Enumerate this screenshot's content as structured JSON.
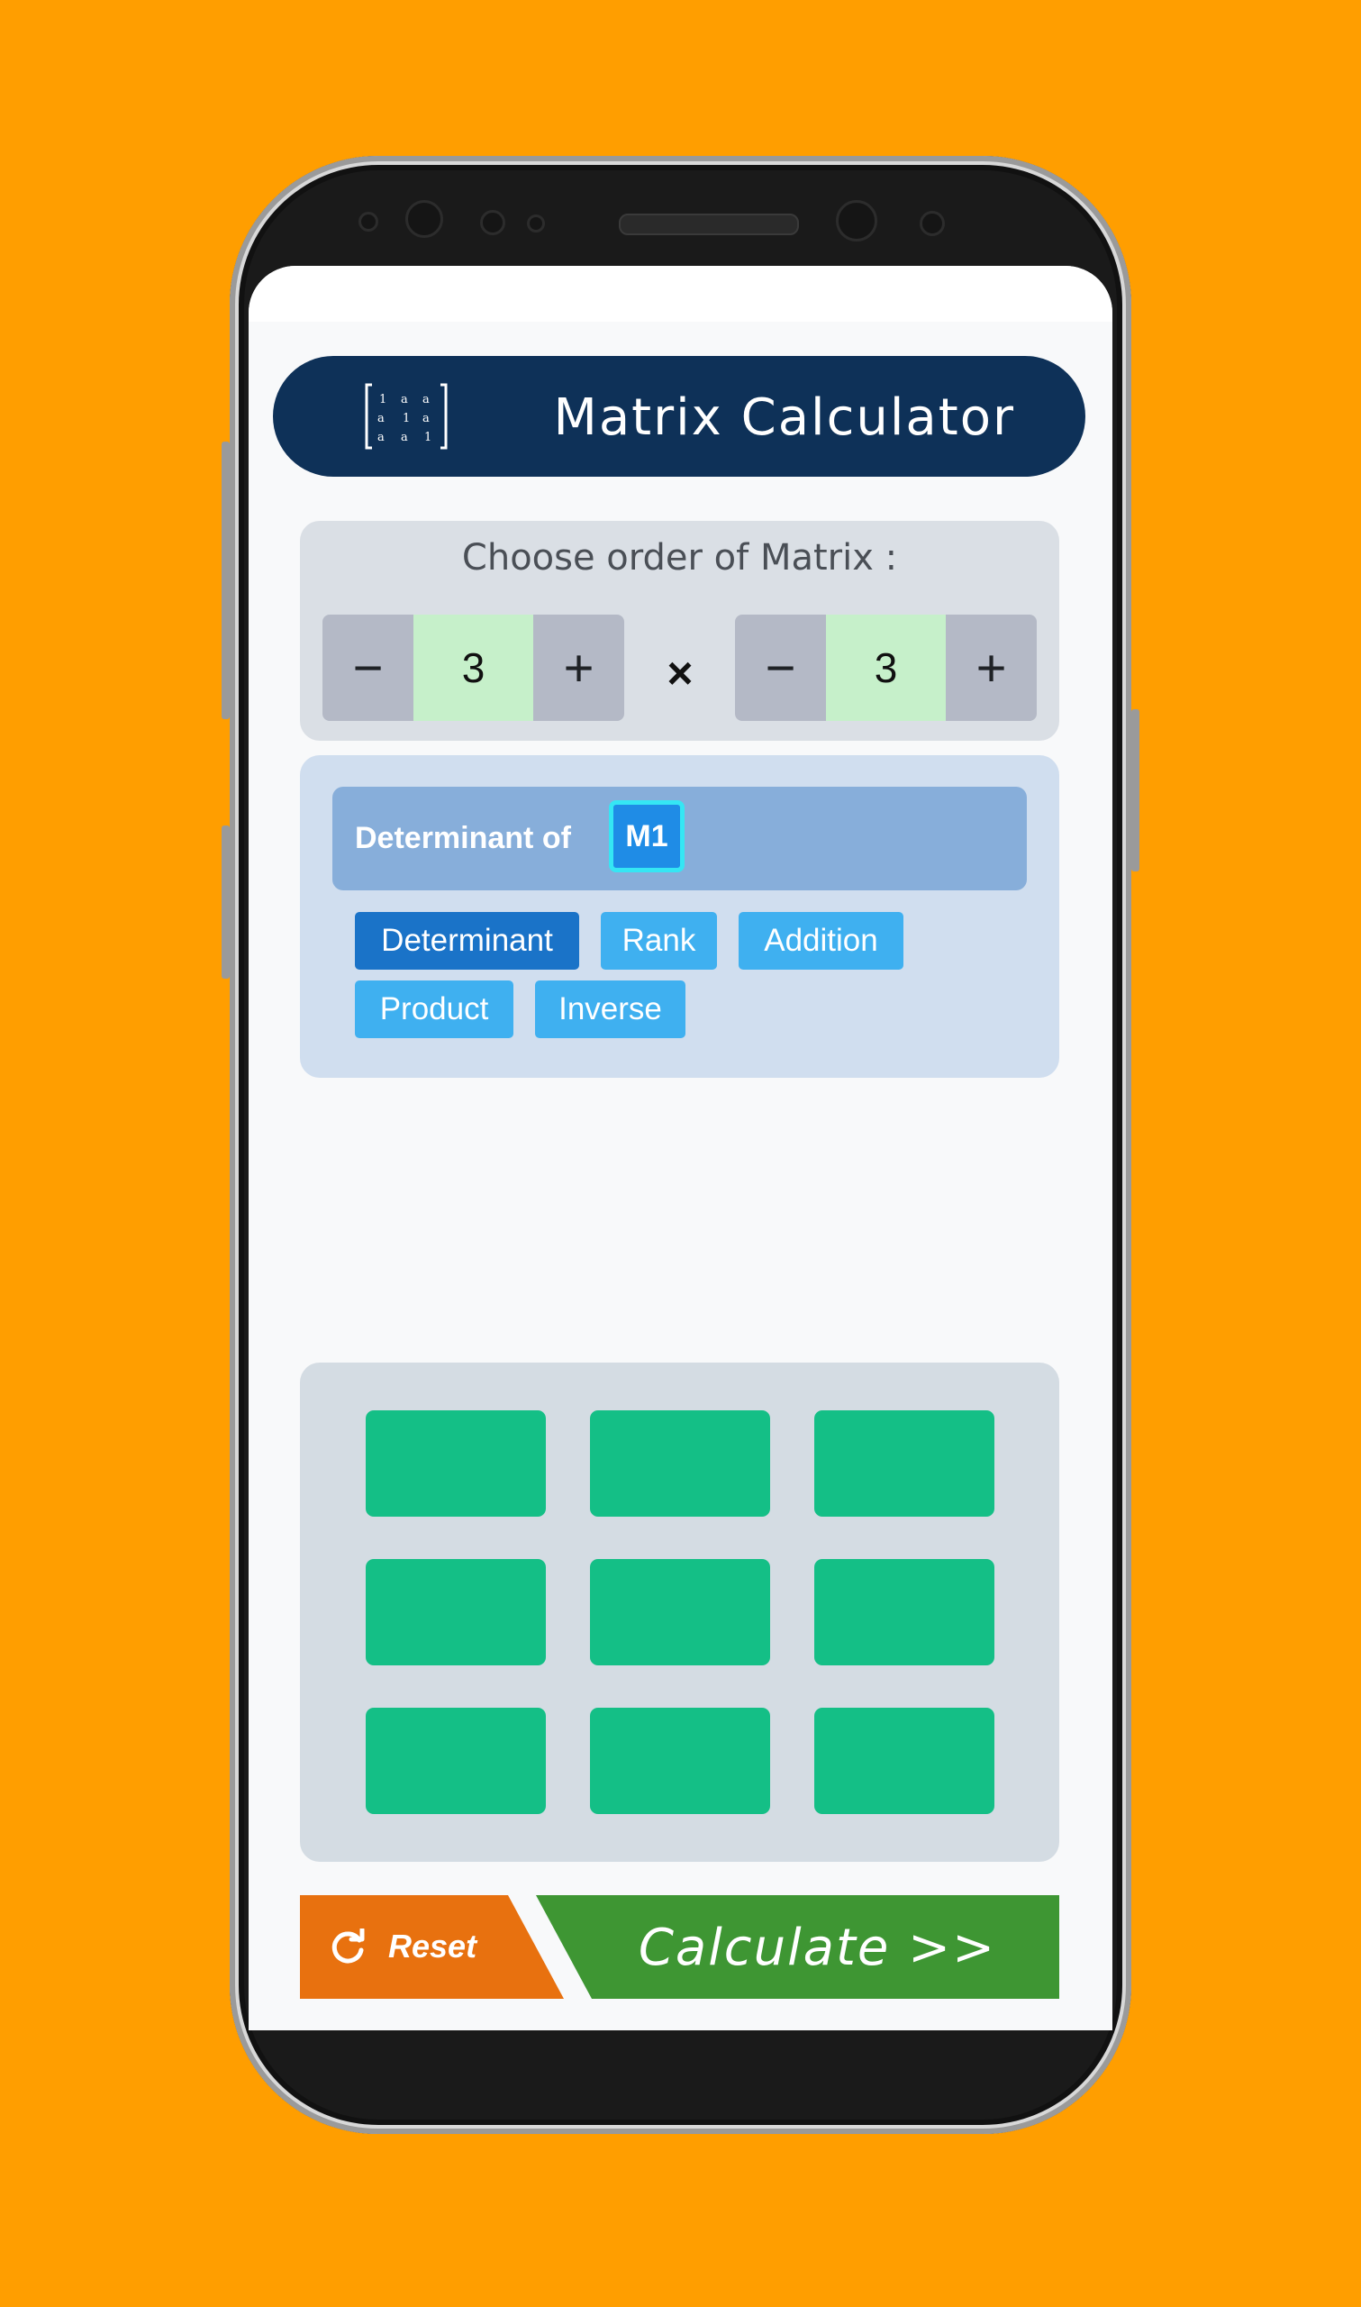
{
  "app": {
    "title": "Matrix  Calculator",
    "logo_icon": "matrix-icon"
  },
  "order": {
    "label": "Choose order of Matrix :",
    "rows": {
      "minus": "−",
      "value": "3",
      "plus": "+"
    },
    "times": "×",
    "cols": {
      "minus": "−",
      "value": "3",
      "plus": "+"
    }
  },
  "operation": {
    "label": "Determinant of",
    "matrix_badge": "M1",
    "chips": [
      {
        "label": "Determinant",
        "active": true
      },
      {
        "label": "Rank",
        "active": false
      },
      {
        "label": "Addition",
        "active": false
      },
      {
        "label": "Product",
        "active": false
      },
      {
        "label": "Inverse",
        "active": false
      }
    ]
  },
  "matrix": {
    "rows": 3,
    "cols": 3,
    "cells": [
      [
        "",
        "",
        ""
      ],
      [
        "",
        "",
        ""
      ],
      [
        "",
        "",
        ""
      ]
    ]
  },
  "actions": {
    "reset_label": "Reset",
    "reset_icon": "refresh-icon",
    "calculate_label": "Calculate  >>"
  },
  "colors": {
    "background": "#FF9E00",
    "header": "#0E3158",
    "cell": "#14BF86",
    "reset": "#E8710F",
    "calculate": "#3E9633",
    "chip_active": "#1A73C8",
    "chip": "#3FB0F0"
  }
}
